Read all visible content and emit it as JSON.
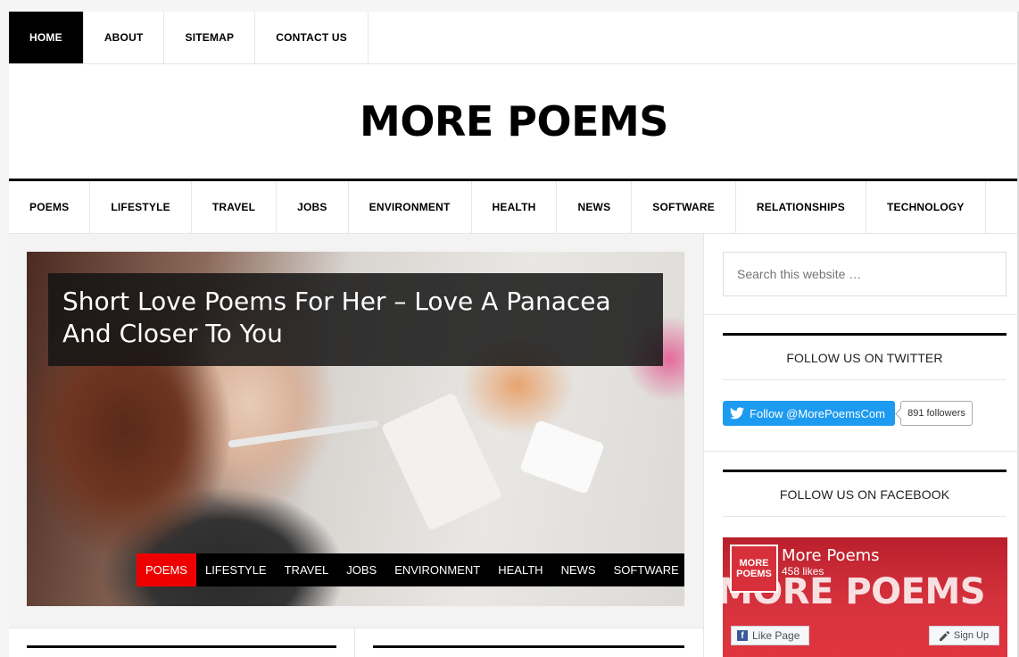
{
  "top_nav": {
    "items": [
      {
        "label": "HOME",
        "active": true
      },
      {
        "label": "ABOUT",
        "active": false
      },
      {
        "label": "SITEMAP",
        "active": false
      },
      {
        "label": "CONTACT US",
        "active": false
      }
    ]
  },
  "site_title": "MORE POEMS",
  "category_nav": {
    "items": [
      "POEMS",
      "LIFESTYLE",
      "TRAVEL",
      "JOBS",
      "ENVIRONMENT",
      "HEALTH",
      "NEWS",
      "SOFTWARE",
      "RELATIONSHIPS",
      "TECHNOLOGY"
    ]
  },
  "featured": {
    "title": "Short Love Poems For Her – Love A Panacea And Closer To You",
    "categories": [
      {
        "label": "POEMS",
        "active": true
      },
      {
        "label": "LIFESTYLE",
        "active": false
      },
      {
        "label": "TRAVEL",
        "active": false
      },
      {
        "label": "JOBS",
        "active": false
      },
      {
        "label": "ENVIRONMENT",
        "active": false
      },
      {
        "label": "HEALTH",
        "active": false
      },
      {
        "label": "NEWS",
        "active": false
      },
      {
        "label": "SOFTWARE",
        "active": false
      }
    ]
  },
  "sidebar": {
    "search_placeholder": "Search this website …",
    "twitter": {
      "title": "FOLLOW US ON TWITTER",
      "button_label": "Follow @MorePoemsCom",
      "followers": "891 followers"
    },
    "facebook": {
      "title": "FOLLOW US ON FACEBOOK",
      "page_name": "More Poems",
      "likes": "458 likes",
      "logo_text": "MORE POEMS",
      "cover_text": "MORE POEMS",
      "like_button": "Like Page",
      "signup_button": "Sign Up"
    }
  },
  "colors": {
    "accent_red": "#e00000",
    "twitter_blue": "#1d9bf0",
    "facebook_red": "#d6323d"
  }
}
